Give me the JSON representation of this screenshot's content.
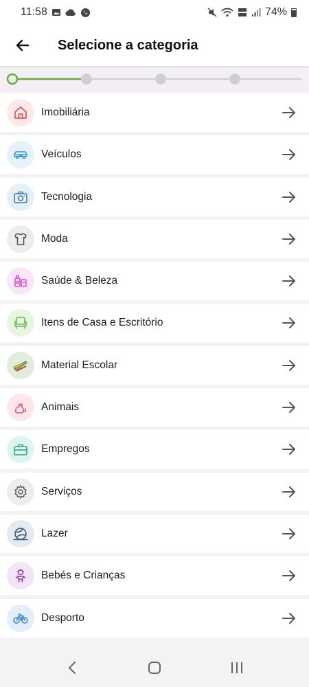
{
  "status_bar": {
    "time": "11:58",
    "battery": "74%",
    "battery_level": 0.74,
    "left_icons": [
      "image-icon",
      "cloud-icon",
      "whatsapp-icon"
    ],
    "right_icons": [
      "mute-icon",
      "wifi-icon",
      "volte-icon",
      "signal-icon",
      "battery-icon"
    ]
  },
  "header": {
    "title": "Selecione a categoria",
    "back_icon": "arrow-left-icon"
  },
  "stepper": {
    "total_steps": 4,
    "current_step": 1,
    "active_color": "#6aa842",
    "inactive_color": "#cfcfcf"
  },
  "categories": [
    {
      "label": "Imobiliária",
      "icon": "house-icon",
      "color": "#e0474c",
      "bg": "#fde9ea"
    },
    {
      "label": "Veículos",
      "icon": "car-icon",
      "color": "#3d9ad8",
      "bg": "#e4f2fb"
    },
    {
      "label": "Tecnologia",
      "icon": "camera-icon",
      "color": "#4a7ba8",
      "bg": "#e4f0f8"
    },
    {
      "label": "Moda",
      "icon": "shirt-icon",
      "color": "#555555",
      "bg": "#ececec"
    },
    {
      "label": "Saúde & Beleza",
      "icon": "cosmetics-icon",
      "color": "#d84ec9",
      "bg": "#fbe6f7"
    },
    {
      "label": "Itens de Casa e Escritório",
      "icon": "armchair-icon",
      "color": "#6abf4b",
      "bg": "#e7f5e2"
    },
    {
      "label": "Material Escolar",
      "icon": "school-supplies-icon",
      "color": "#4e8a3a",
      "bg": "#e2ecdd"
    },
    {
      "label": "Animais",
      "icon": "cat-icon",
      "color": "#e05b72",
      "bg": "#fde7ec"
    },
    {
      "label": "Empregos",
      "icon": "briefcase-icon",
      "color": "#27a58a",
      "bg": "#e0f4ef"
    },
    {
      "label": "Serviços",
      "icon": "gear-icon",
      "color": "#666666",
      "bg": "#ededed"
    },
    {
      "label": "Lazer",
      "icon": "beach-ball-icon",
      "color": "#3a5a78",
      "bg": "#e3eaf1"
    },
    {
      "label": "Bebés e Crianças",
      "icon": "child-icon",
      "color": "#9a3fb8",
      "bg": "#f1e6f6"
    },
    {
      "label": "Desporto",
      "icon": "bicycle-icon",
      "color": "#3d88c6",
      "bg": "#e3eff8"
    }
  ],
  "row_arrow_icon": "arrow-right-icon",
  "nav_bar": {
    "buttons": [
      "back-nav-icon",
      "home-nav-icon",
      "recents-nav-icon"
    ]
  }
}
